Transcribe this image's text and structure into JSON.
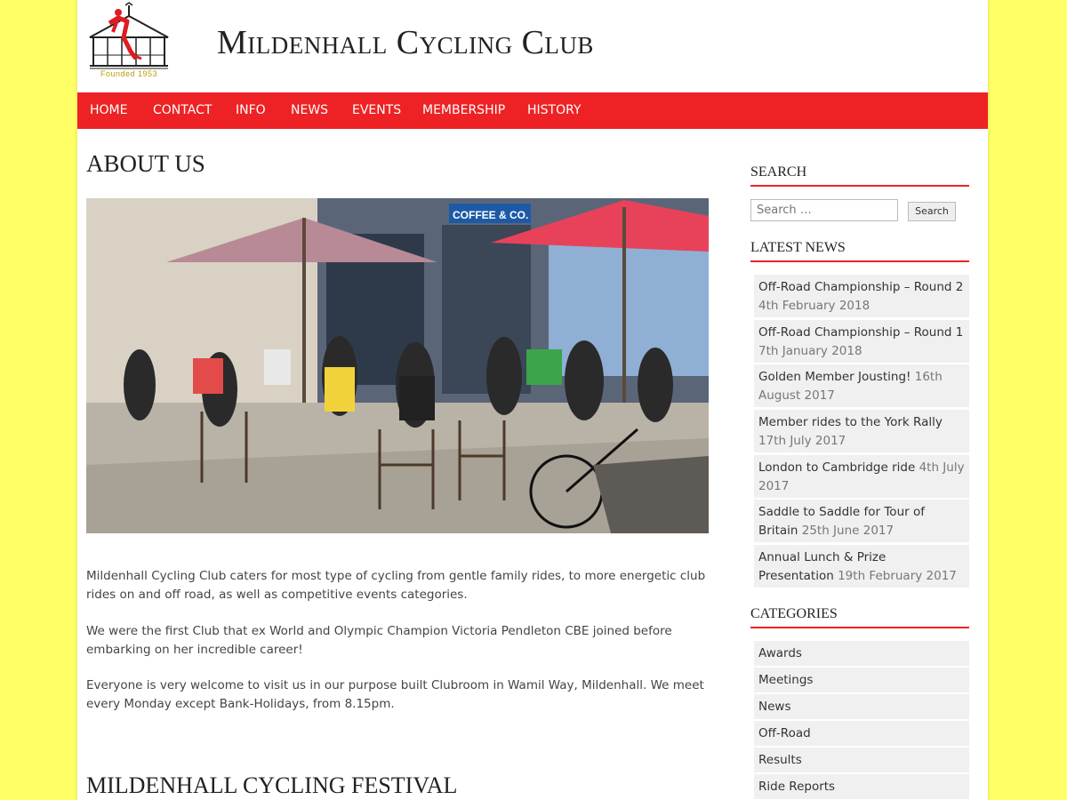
{
  "site": {
    "title": "Mildenhall Cycling Club",
    "logo_caption": "Founded 1953"
  },
  "colors": {
    "background": "#ffff66",
    "accent": "#ee2224",
    "logo_red": "#e01b22",
    "logo_gold": "#b8a000"
  },
  "nav": {
    "items": [
      {
        "label": "HOME"
      },
      {
        "label": "CONTACT"
      },
      {
        "label": "INFO"
      },
      {
        "label": "NEWS"
      },
      {
        "label": "EVENTS"
      },
      {
        "label": "MEMBERSHIP"
      },
      {
        "label": "HISTORY"
      }
    ]
  },
  "main": {
    "title": "ABOUT US",
    "paragraphs": [
      "Mildenhall Cycling Club caters for most type of cycling from gentle family rides, to more energetic club rides on and off road, as well as competitive events categories.",
      "We were the first Club that ex World and Olympic Champion Victoria Pendleton CBE joined before embarking on her incredible career!",
      "Everyone is very welcome to visit us in our purpose built Clubroom in Wamil Way, Mildenhall. We meet every Monday except Bank-Holidays, from 8.15pm."
    ],
    "section_title": "MILDENHALL CYCLING FESTIVAL",
    "photo_sign": "COFFEE & CO."
  },
  "sidebar": {
    "search": {
      "title": "SEARCH",
      "placeholder": "Search …",
      "button_label": "Search"
    },
    "latest_news": {
      "title": "LATEST NEWS",
      "items": [
        {
          "title": "Off-Road Championship – Round 2",
          "date": "4th February 2018"
        },
        {
          "title": "Off-Road Championship – Round 1",
          "date": "7th January 2018"
        },
        {
          "title": "Golden Member Jousting!",
          "date": "16th August 2017"
        },
        {
          "title": "Member rides to the York Rally",
          "date": "17th July 2017"
        },
        {
          "title": "London to Cambridge ride",
          "date": "4th July 2017"
        },
        {
          "title": "Saddle to Saddle for Tour of Britain",
          "date": "25th June 2017"
        },
        {
          "title": "Annual Lunch & Prize Presentation",
          "date": "19th February 2017"
        }
      ]
    },
    "categories": {
      "title": "CATEGORIES",
      "items": [
        {
          "label": "Awards"
        },
        {
          "label": "Meetings"
        },
        {
          "label": "News"
        },
        {
          "label": "Off-Road"
        },
        {
          "label": "Results"
        },
        {
          "label": "Ride Reports"
        }
      ]
    }
  }
}
